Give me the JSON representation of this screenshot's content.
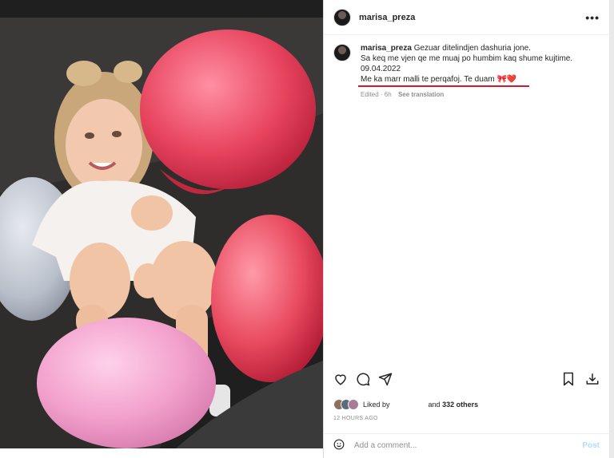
{
  "post": {
    "username": "marisa_preza",
    "caption": {
      "username": "marisa_preza",
      "line1": "Gezuar ditelindjen dashuria jone.",
      "line2": "Sa keq me vjen qe me muaj po humbim kaq shume kujtime.",
      "line3": "09.04.2022",
      "line4": "Me ka marr malli te perqafoj. Te duam 🎀❤️"
    },
    "meta": {
      "edited": "Edited · 6h",
      "see_translation": "See translation"
    },
    "likes": {
      "liked_by": "Liked by",
      "and": "and",
      "others": "332 others"
    },
    "timestamp": "12 HOURS AGO",
    "comment": {
      "placeholder": "Add a comment...",
      "post_label": "Post"
    }
  },
  "colors": {
    "underline": "#d11a2a",
    "post_button": "#b3dbff"
  },
  "icons": [
    "more-icon",
    "heart-icon",
    "comment-icon",
    "share-icon",
    "bookmark-icon",
    "download-icon",
    "emoji-icon"
  ]
}
